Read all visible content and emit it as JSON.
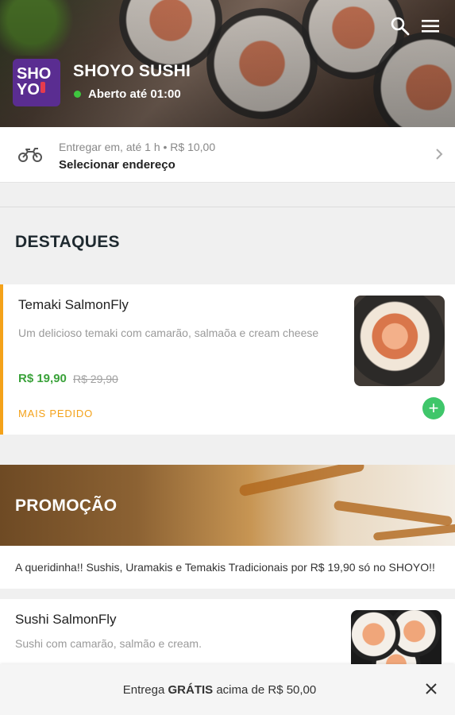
{
  "store": {
    "logo_text_top": "SHO",
    "logo_text_bottom": "YO",
    "name": "SHOYO SUSHI",
    "status": "Aberto até 01:00",
    "status_color": "#3fc63f"
  },
  "header": {
    "icons": [
      "search-icon",
      "menu-icon"
    ]
  },
  "delivery": {
    "line1": "Entregar em, até 1 h • R$ 10,00",
    "line2": "Selecionar endereço",
    "icon": "motorcycle-icon"
  },
  "highlights": {
    "title": "DESTAQUES",
    "item": {
      "name": "Temaki SalmonFly",
      "description": "Um delicioso temaki com camarão, salmaõa e cream cheese",
      "price": "R$ 19,90",
      "old_price": "R$ 29,90",
      "tag": "MAIS PEDIDO",
      "add_label": "+"
    }
  },
  "promo": {
    "title": "PROMOÇÃO",
    "description": "A queridinha!! Sushis, Uramakis e Temakis Tradicionais por R$ 19,90 só no SHOYO!!",
    "item": {
      "name": "Sushi SalmonFly",
      "description": "Sushi com camarão, salmão e cream."
    }
  },
  "bottom_banner": {
    "prefix": "Entrega ",
    "bold": "GRÁTIS",
    "suffix": " acima de R$ 50,00"
  },
  "colors": {
    "brand": "#5a2d91",
    "accent": "#f4a21a",
    "price": "#3aa23a",
    "add_button": "#3fc66a"
  }
}
